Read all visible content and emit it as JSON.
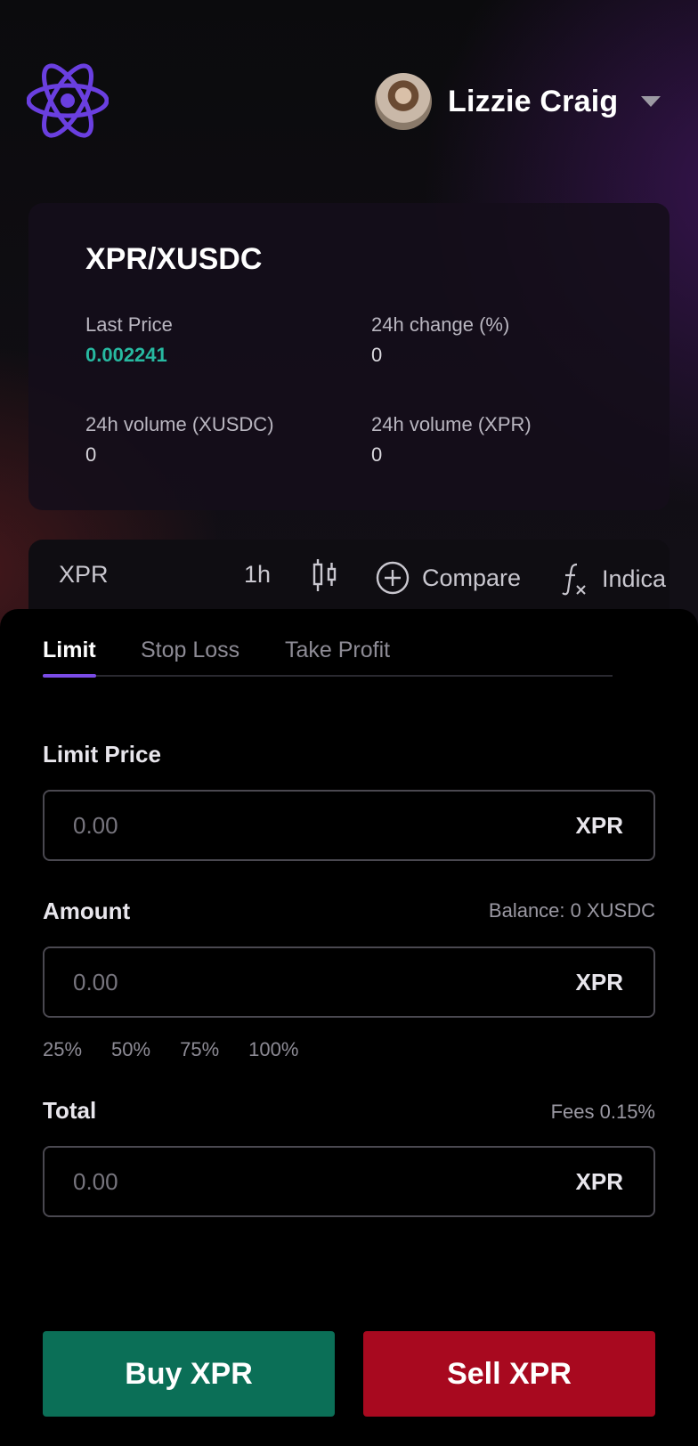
{
  "header": {
    "user_name": "Lizzie Craig"
  },
  "market": {
    "pair": "XPR/XUSDC",
    "last_price_label": "Last Price",
    "last_price_value": "0.002241",
    "change_label": "24h change (%)",
    "change_value": "0",
    "vol_quote_label": "24h volume (XUSDC)",
    "vol_quote_value": "0",
    "vol_base_label": "24h volume (XPR)",
    "vol_base_value": "0"
  },
  "chart_toolbar": {
    "symbol": "XPR",
    "interval": "1h",
    "compare_label": "Compare",
    "indicators_label": "Indica"
  },
  "order": {
    "tabs": [
      {
        "label": "Limit",
        "active": true
      },
      {
        "label": "Stop Loss",
        "active": false
      },
      {
        "label": "Take Profit",
        "active": false
      }
    ],
    "limit_price_label": "Limit Price",
    "limit_price_placeholder": "0.00",
    "limit_price_unit": "XPR",
    "amount_label": "Amount",
    "balance_text": "Balance: 0 XUSDC",
    "amount_placeholder": "0.00",
    "amount_unit": "XPR",
    "percentages": [
      "25%",
      "50%",
      "75%",
      "100%"
    ],
    "total_label": "Total",
    "fees_text": "Fees 0.15%",
    "total_placeholder": "0.00",
    "total_unit": "XPR",
    "buy_label": "Buy XPR",
    "sell_label": "Sell XPR"
  },
  "colors": {
    "accent": "#7a4be6",
    "positive": "#27b9a1",
    "buy": "#0b6f57",
    "sell": "#a8091f"
  },
  "icons": {
    "logo": "atom-logo-icon",
    "user_menu": "caret-down-icon",
    "chart_type": "candlestick-icon",
    "compare": "plus-circle-icon",
    "indicators": "function-icon"
  }
}
